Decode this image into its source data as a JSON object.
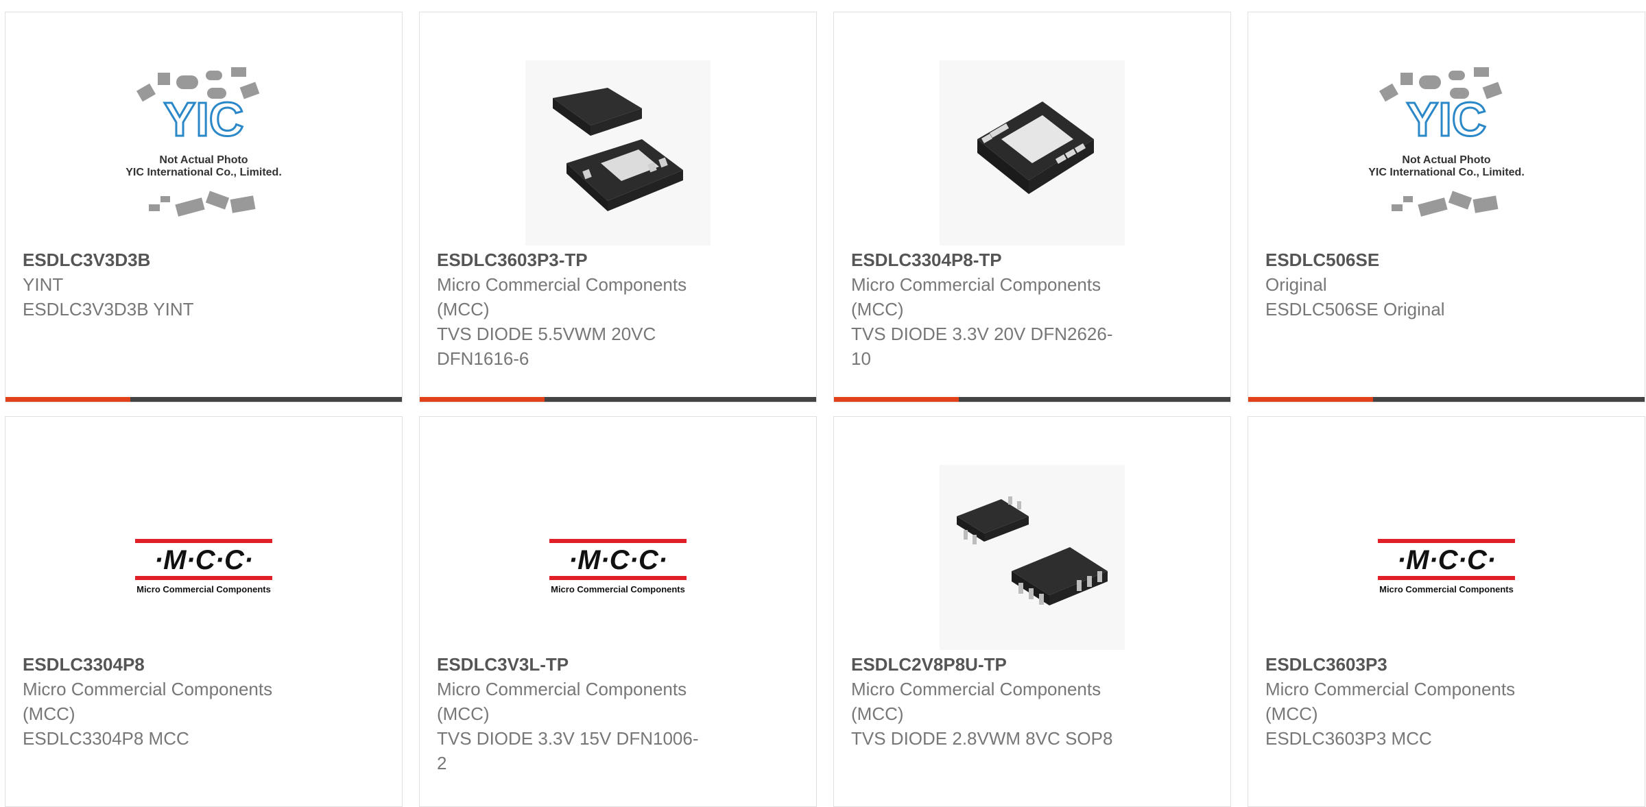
{
  "colors": {
    "accent": "#e2421a",
    "bar": "#444444",
    "title": "#555555",
    "text": "#777777"
  },
  "products": [
    {
      "part": "ESDLC3V3D3B",
      "lines": [
        "YINT",
        "ESDLC3V3D3B YINT"
      ],
      "image": "yic-placeholder",
      "image_text": [
        "Not Actual Photo",
        "YIC International Co., Limited."
      ]
    },
    {
      "part": "ESDLC3603P3-TP",
      "lines": [
        "Micro Commercial Components",
        "(MCC)",
        "TVS DIODE 5.5VWM 20VC",
        "DFN1616-6"
      ],
      "image": "dfn6-chip-photo"
    },
    {
      "part": "ESDLC3304P8-TP",
      "lines": [
        "Micro Commercial Components",
        "(MCC)",
        "TVS DIODE 3.3V 20V DFN2626-",
        "10"
      ],
      "image": "dfn10-chip-photo"
    },
    {
      "part": "ESDLC506SE",
      "lines": [
        "Original",
        "ESDLC506SE Original"
      ],
      "image": "yic-placeholder",
      "image_text": [
        "Not Actual Photo",
        "YIC International Co., Limited."
      ]
    },
    {
      "part": "ESDLC3304P8",
      "lines": [
        "Micro Commercial Components",
        "(MCC)",
        "ESDLC3304P8 MCC"
      ],
      "image": "mcc-logo",
      "image_text": [
        "·M·C·C·",
        "Micro Commercial Components"
      ]
    },
    {
      "part": "ESDLC3V3L-TP",
      "lines": [
        "Micro Commercial Components",
        "(MCC)",
        "TVS DIODE 3.3V 15V DFN1006-",
        "2"
      ],
      "image": "mcc-logo",
      "image_text": [
        "·M·C·C·",
        "Micro Commercial Components"
      ]
    },
    {
      "part": "ESDLC2V8P8U-TP",
      "lines": [
        "Micro Commercial Components",
        "(MCC)",
        "TVS DIODE 2.8VWM 8VC SOP8"
      ],
      "image": "sop8-chip-photo"
    },
    {
      "part": "ESDLC3603P3",
      "lines": [
        "Micro Commercial Components",
        "(MCC)",
        "ESDLC3603P3 MCC"
      ],
      "image": "mcc-logo",
      "image_text": [
        "·M·C·C·",
        "Micro Commercial Components"
      ]
    }
  ]
}
